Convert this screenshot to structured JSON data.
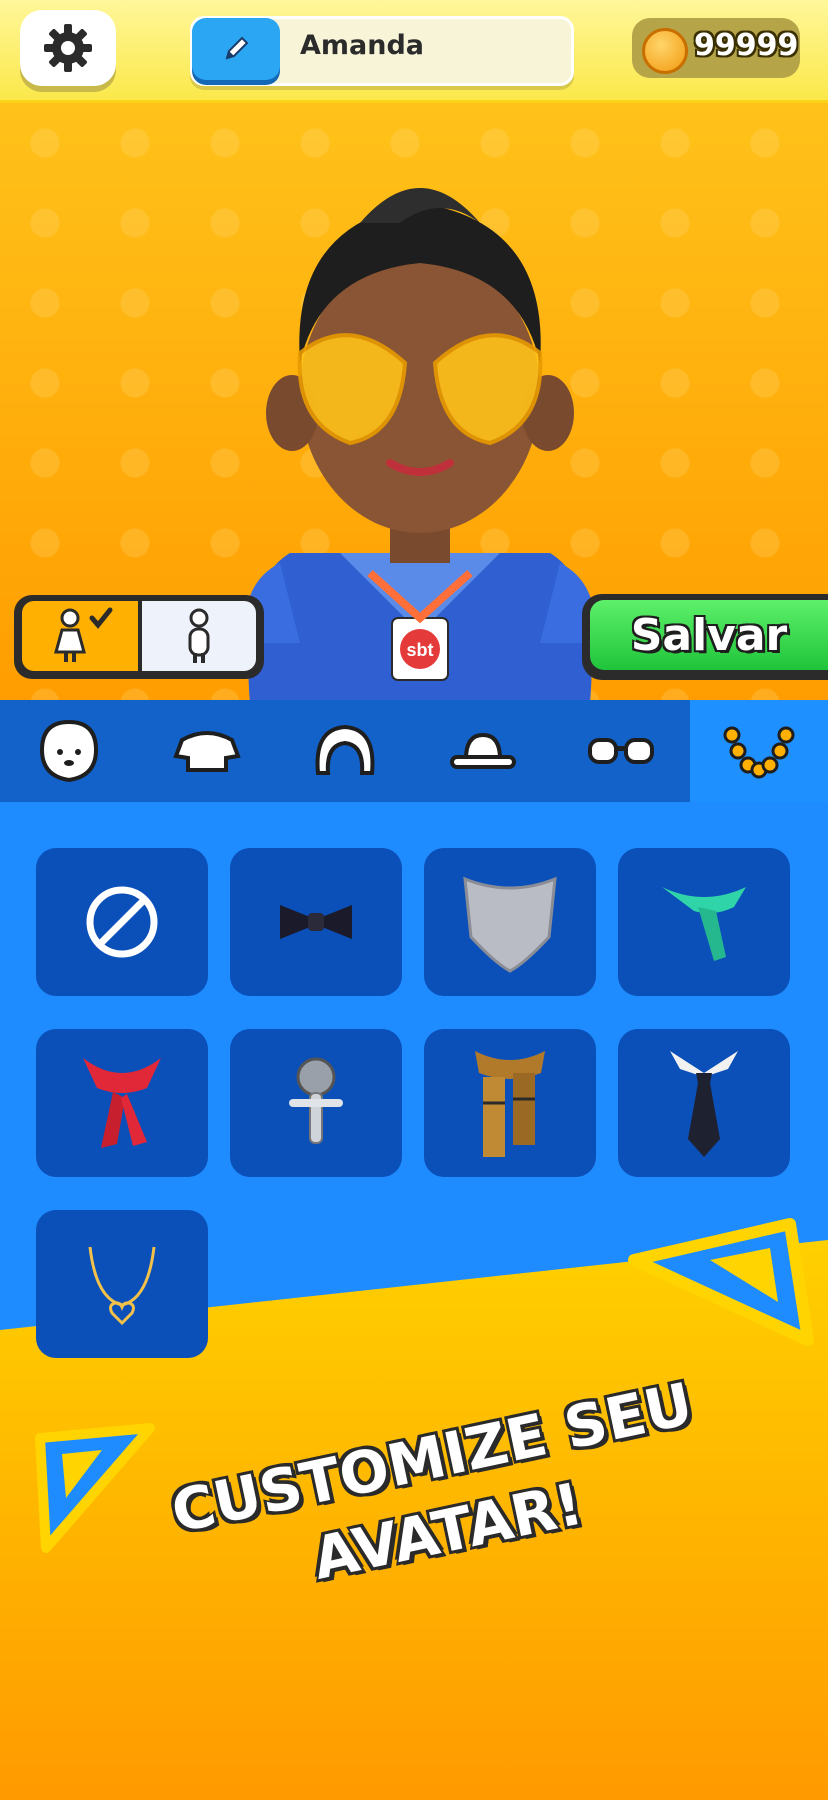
{
  "header": {
    "player_name": "Amanda",
    "coins": "99999",
    "icons": {
      "settings": "gear-icon",
      "edit": "pencil-icon",
      "coin": "coin-icon"
    }
  },
  "avatar": {
    "gender_options": [
      "female",
      "male"
    ],
    "selected_gender": "female",
    "badge_text": "sbt"
  },
  "actions": {
    "save_label": "Salvar"
  },
  "categories": [
    {
      "icon": "face-icon",
      "active": false
    },
    {
      "icon": "shirt-icon",
      "active": false
    },
    {
      "icon": "hair-icon",
      "active": false
    },
    {
      "icon": "hat-icon",
      "active": false
    },
    {
      "icon": "glasses-icon",
      "active": false
    },
    {
      "icon": "necklace-icon",
      "active": true
    }
  ],
  "items": [
    {
      "icon": "none-icon"
    },
    {
      "icon": "bowtie-icon"
    },
    {
      "icon": "knit-scarf-icon"
    },
    {
      "icon": "green-scarf-icon"
    },
    {
      "icon": "red-scarf-icon"
    },
    {
      "icon": "microphone-icon"
    },
    {
      "icon": "plaid-scarf-icon"
    },
    {
      "icon": "necktie-icon"
    },
    {
      "icon": "heart-necklace-icon"
    }
  ],
  "promo": {
    "line1": "CUSTOMIZE SEU",
    "line2": "AVATAR!"
  },
  "colors": {
    "primary_blue": "#1e8cff",
    "tile_blue": "#0b4fb8",
    "save_green": "#22c93e",
    "accent_yellow": "#ffc21a"
  }
}
